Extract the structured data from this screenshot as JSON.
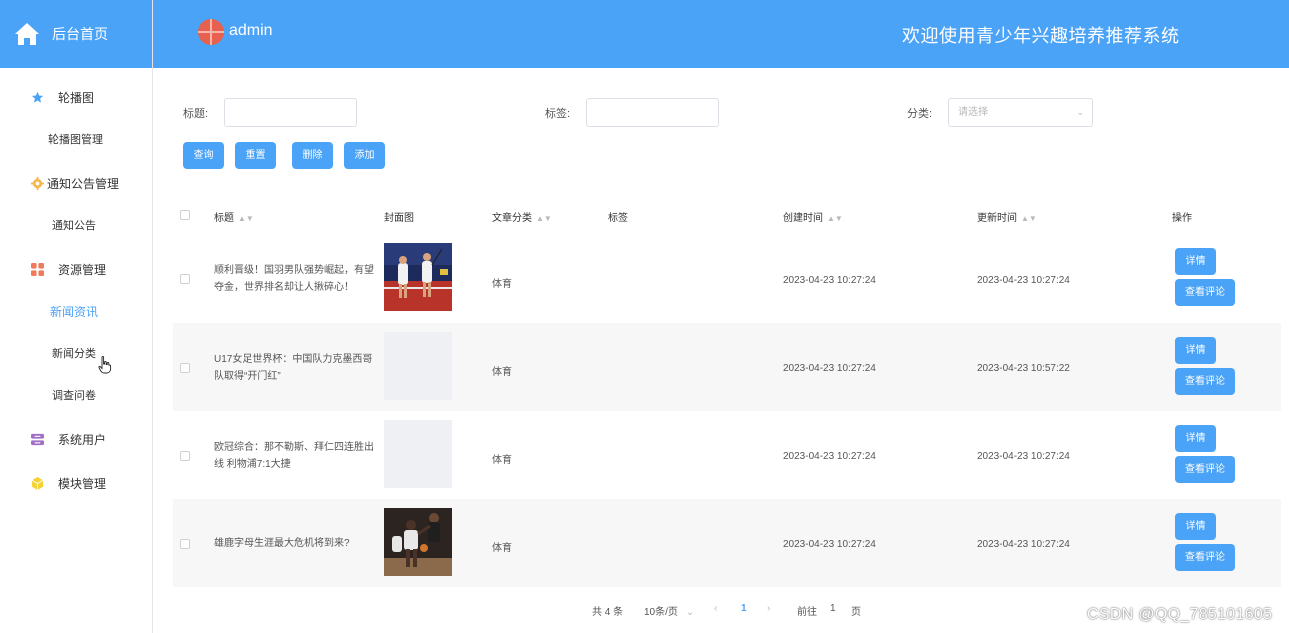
{
  "sidebar": {
    "home_label": "后台首页",
    "groups": [
      {
        "label": "轮播图",
        "icon": "star-icon",
        "items": [
          "轮播图管理"
        ]
      },
      {
        "label": "通知公告管理",
        "icon": "gear-icon",
        "items": [
          "通知公告"
        ]
      },
      {
        "label": "资源管理",
        "icon": "grid-icon",
        "items": [
          "新闻资讯",
          "新闻分类",
          "调查问卷"
        ]
      },
      {
        "label": "系统用户",
        "icon": "user-box-icon",
        "items": []
      },
      {
        "label": "模块管理",
        "icon": "cube-icon",
        "items": []
      }
    ],
    "active_item": "新闻资讯"
  },
  "header": {
    "username": "admin",
    "system_title": "欢迎使用青少年兴趣培养推荐系统"
  },
  "filters": {
    "title_label": "标题:",
    "tag_label": "标签:",
    "category_label": "分类:",
    "category_placeholder": "请选择",
    "buttons": {
      "search": "查询",
      "reset": "重置",
      "delete": "删除",
      "add": "添加"
    }
  },
  "table": {
    "columns": [
      "标题",
      "封面图",
      "文章分类",
      "标签",
      "创建时间",
      "更新时间",
      "操作"
    ],
    "rows": [
      {
        "title": "顺利晋级！国羽男队强势崛起，有望夺金，世界排名却让人揪碎心！",
        "cover": "badminton-photo",
        "category": "体育",
        "tag": "",
        "created": "2023-04-23 10:27:24",
        "updated": "2023-04-23 10:27:24"
      },
      {
        "title": "U17女足世界杯：中国队力克墨西哥队取得“开门红”",
        "cover": "",
        "category": "体育",
        "tag": "",
        "created": "2023-04-23 10:27:24",
        "updated": "2023-04-23 10:57:22"
      },
      {
        "title": "欧冠综合：那不勒斯、拜仁四连胜出线 利物浦7:1大捷",
        "cover": "",
        "category": "体育",
        "tag": "",
        "created": "2023-04-23 10:27:24",
        "updated": "2023-04-23 10:27:24"
      },
      {
        "title": "雄鹿字母生涯最大危机将到来?",
        "cover": "basketball-photo",
        "category": "体育",
        "tag": "",
        "created": "2023-04-23 10:27:24",
        "updated": "2023-04-23 10:27:24"
      }
    ],
    "row_actions": {
      "detail": "详情",
      "comments": "查看评论"
    }
  },
  "pagination": {
    "total": "共 4 条",
    "page_size": "10条/页",
    "current_page": "1",
    "goto_label": "前往",
    "goto_value": "1",
    "page_suffix": "页"
  },
  "watermark": "CSDN @QQ_785101605",
  "colors": {
    "primary": "#4ba3f7",
    "header_bg": "#4ba3f7",
    "row_alt": "#f7f7f8"
  }
}
